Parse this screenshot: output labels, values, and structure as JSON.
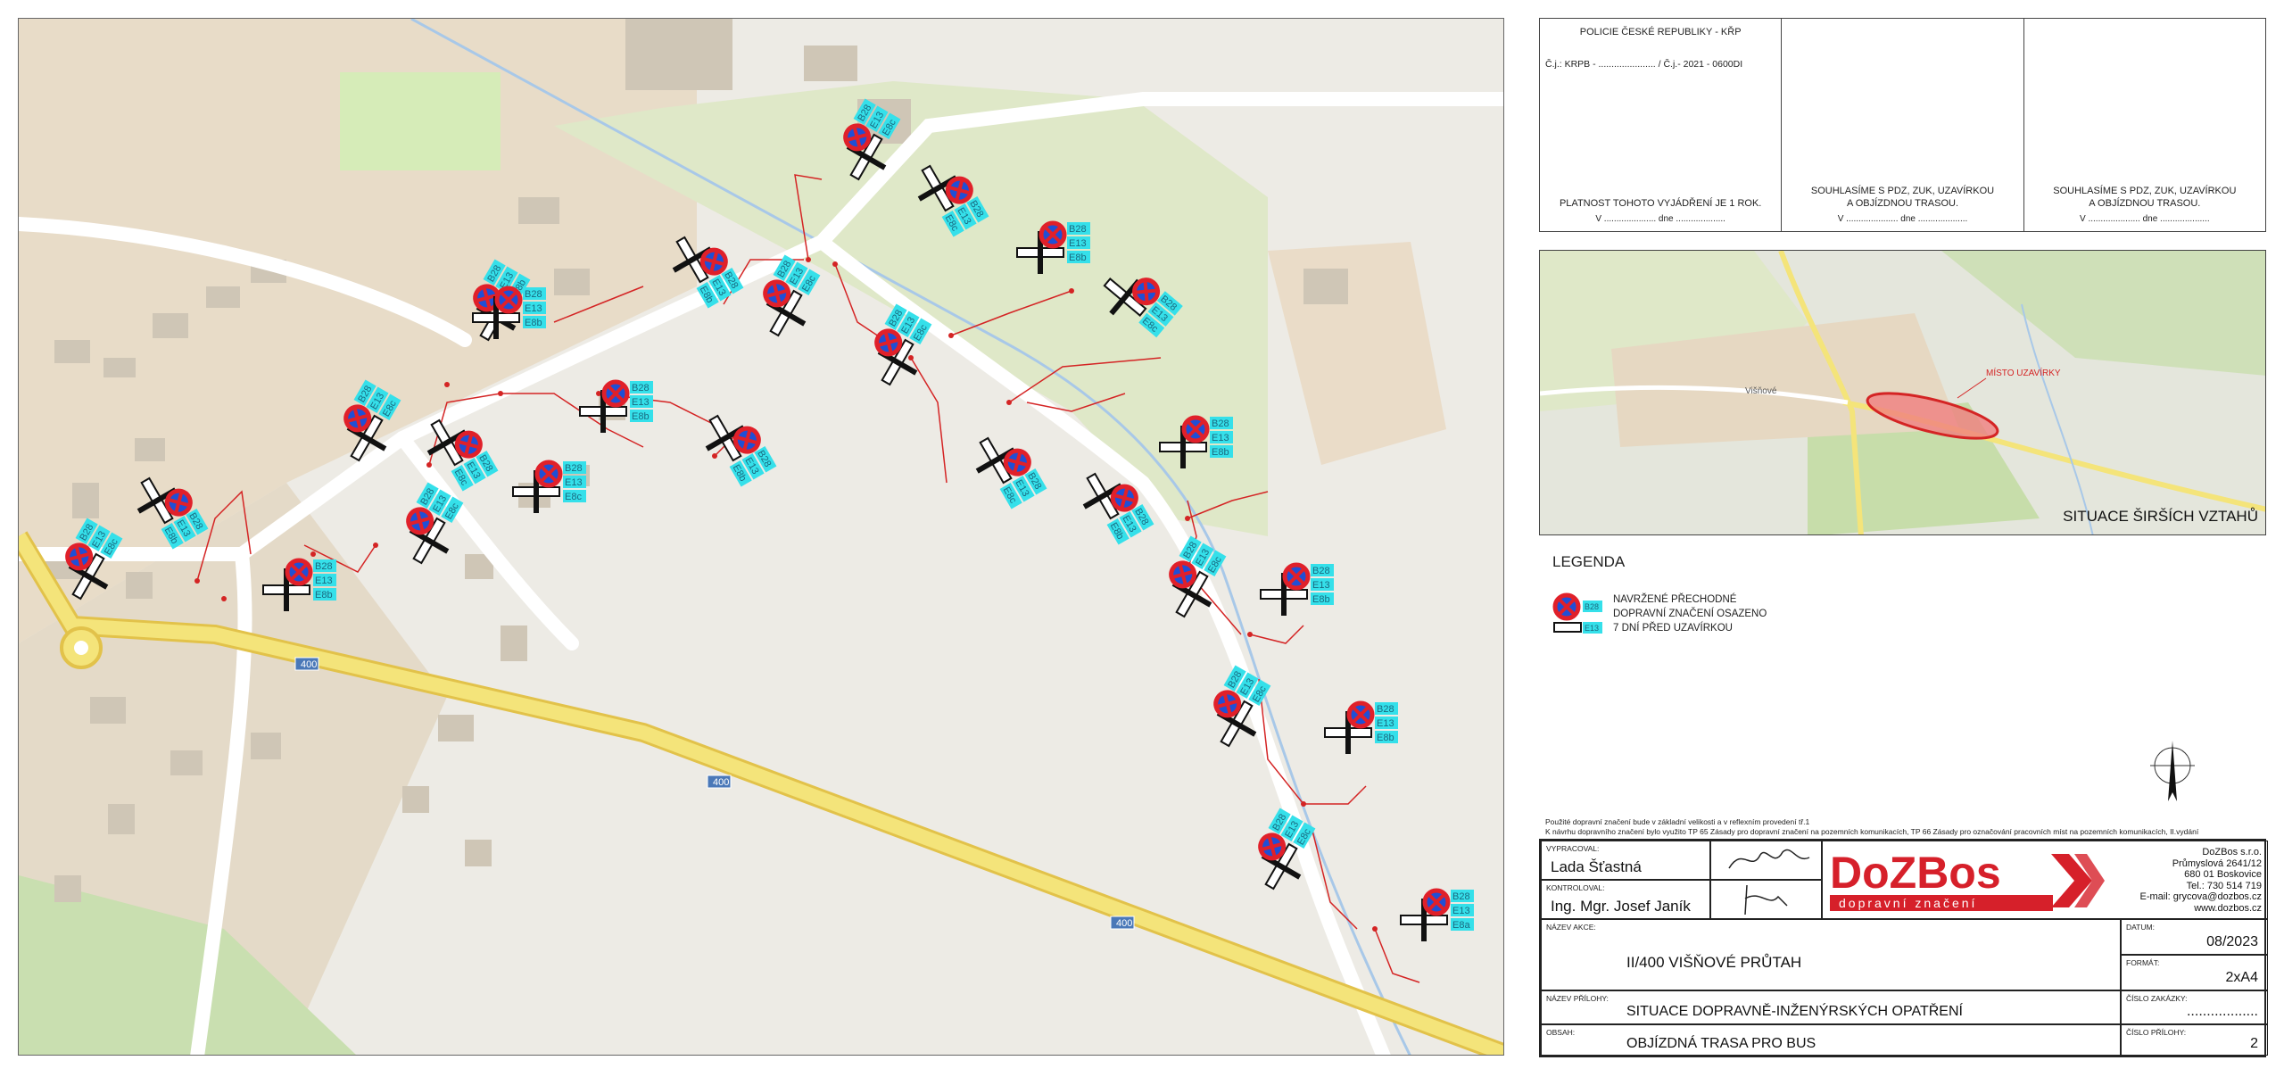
{
  "approvals": [
    {
      "title": "POLICIE ČESKÉ REPUBLIKY - KŘP",
      "ref": "Č.j.: KRPB - ...................... / Č.j.- 2021 - 0600DI",
      "note_line1": "PLATNOST TOHOTO VYJÁDŘENÍ JE 1 ROK.",
      "note_line2": "",
      "signature": "V ..................... dne ...................."
    },
    {
      "title": "",
      "ref": "",
      "note_line1": "SOUHLASÍME S PDZ, ZUK, UZAVÍRKOU",
      "note_line2": "A OBJÍZDNOU TRASOU.",
      "signature": "V ..................... dne ...................."
    },
    {
      "title": "",
      "ref": "",
      "note_line1": "SOUHLASÍME S PDZ, ZUK, UZAVÍRKOU",
      "note_line2": "A OBJÍZDNOU TRASOU.",
      "signature": "V ..................... dne ...................."
    }
  ],
  "overview": {
    "caption": "SITUACE ŠIRŠÍCH VZTAHŮ",
    "village_label": "Višňové",
    "closure_label": "MÍSTO UZAVÍRKY"
  },
  "legend": {
    "title": "LEGENDA",
    "line1": "NAVRŽENÉ PŘECHODNÉ",
    "line2": "DOPRAVNÍ ZNAČENÍ OSAZENO",
    "line3": "7 DNÍ PŘED UZAVÍRKOU",
    "sign_code_1": "B28",
    "sign_code_2": "E13"
  },
  "note": {
    "line1": "Použité dopravní značení bude v základní velikosti a v reflexním provedení tř.1",
    "line2": "K návrhu dopravního značení bylo využito TP 65 Zásady pro dopravní značení na pozemních komunikacích, TP 66 Zásady pro označování pracovních míst na pozemních komunikacích, II.vydání"
  },
  "titleblock": {
    "designer_label": "VYPRACOVAL:",
    "designer": "Lada Šťastná",
    "checker_label": "KONTROLOVAL:",
    "checker": "Ing. Mgr. Josef Janík",
    "company_logo": "DoZBos",
    "company_tagline": "dopravní značení",
    "company_name": "DoZBos s.r.o.",
    "company_street": "Průmyslová 2641/12",
    "company_city": "680 01 Boskovice",
    "company_phone": "Tel.: 730 514 719",
    "company_email": "E-mail: grycova@dozbos.cz",
    "company_web": "www.dozbos.cz",
    "action_label": "NÁZEV AKCE:",
    "action": "II/400 VIŠŇOVÉ PRŮTAH",
    "date_label": "DATUM:",
    "date": "08/2023",
    "format_label": "FORMÁT:",
    "format": "2xA4",
    "attachment_label": "NÁZEV PŘÍLOHY:",
    "attachment": "SITUACE DOPRAVNĚ-INŽENÝRSKÝCH OPATŘENÍ",
    "order_label": "ČÍSLO ZAKÁZKY:",
    "order": "..................",
    "content_label": "OBSAH:",
    "content": "OBJÍZDNÁ TRASA PRO BUS",
    "attach_no_label": "ČÍSLO PŘÍLOHY:",
    "attach_no": "2"
  },
  "map": {
    "road_number": "400",
    "sign_codes": [
      "B28",
      "E13",
      "E8b",
      "E8c",
      "E8a"
    ],
    "colors": {
      "sign_red": "#e0202a",
      "sign_blue": "#1f4fd6",
      "label_cyan": "#35e0ea",
      "road_yellow": "#f4e47a",
      "route_red": "#d42424"
    },
    "sign_groups": [
      {
        "codes": [
          "B28",
          "E13",
          "E8c"
        ]
      },
      {
        "codes": [
          "B28",
          "E13",
          "E8c"
        ]
      },
      {
        "codes": [
          "B28",
          "E13",
          "E8b"
        ]
      },
      {
        "codes": [
          "B28",
          "E13",
          "E8c"
        ]
      },
      {
        "codes": [
          "B28",
          "E13",
          "E8b"
        ]
      },
      {
        "codes": [
          "B28",
          "E13",
          "E8c"
        ]
      },
      {
        "codes": [
          "B28",
          "E13",
          "E8c"
        ]
      },
      {
        "codes": [
          "B28",
          "E13",
          "E8b"
        ]
      },
      {
        "codes": [
          "B28",
          "E13",
          "E8b"
        ]
      },
      {
        "codes": [
          "B28",
          "E13",
          "E8c"
        ]
      },
      {
        "codes": [
          "B28",
          "E13",
          "E8c"
        ]
      },
      {
        "codes": [
          "B28",
          "E13",
          "E8b"
        ]
      },
      {
        "codes": [
          "B28",
          "E13",
          "E8b"
        ]
      },
      {
        "codes": [
          "B28",
          "E13",
          "E8c"
        ]
      },
      {
        "codes": [
          "B28",
          "E13",
          "E8c"
        ]
      },
      {
        "codes": [
          "B28",
          "E13",
          "E8b"
        ]
      },
      {
        "codes": [
          "B28",
          "E13",
          "E8b"
        ]
      },
      {
        "codes": [
          "B28",
          "E13",
          "E8c"
        ]
      },
      {
        "codes": [
          "B28",
          "E13",
          "E8b"
        ]
      },
      {
        "codes": [
          "B28",
          "E13",
          "E8c"
        ]
      },
      {
        "codes": [
          "B28",
          "E13",
          "E8b"
        ]
      },
      {
        "codes": [
          "B28",
          "E13",
          "E8c"
        ]
      },
      {
        "codes": [
          "B28",
          "E13",
          "E8b"
        ]
      },
      {
        "codes": [
          "B28",
          "E13",
          "E8c"
        ]
      },
      {
        "codes": [
          "B28",
          "E13",
          "E8b"
        ]
      },
      {
        "codes": [
          "B28",
          "E13",
          "E8c"
        ]
      },
      {
        "codes": [
          "B28",
          "E13",
          "E8a"
        ]
      }
    ]
  }
}
